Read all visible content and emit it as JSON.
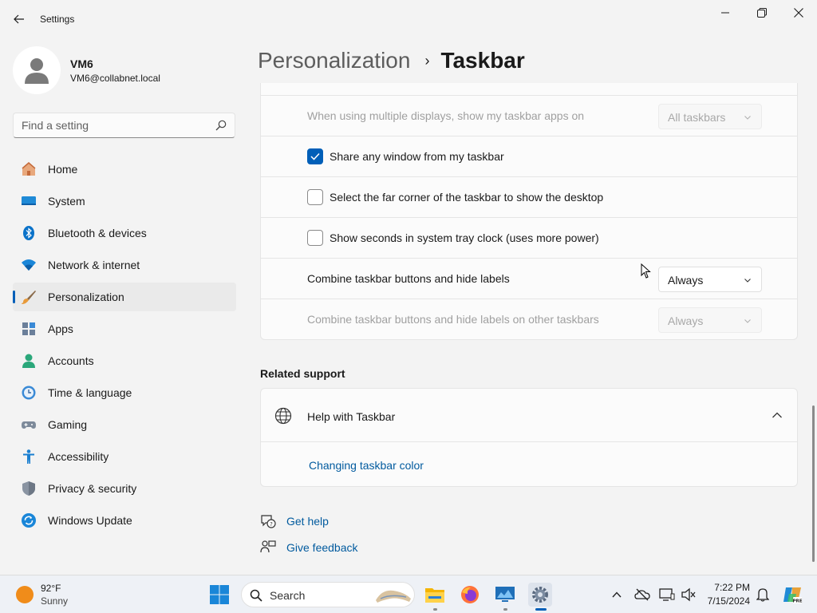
{
  "window": {
    "title": "Settings"
  },
  "user": {
    "name": "VM6",
    "email": "VM6@collabnet.local"
  },
  "search": {
    "placeholder": "Find a setting"
  },
  "sidebar": {
    "items": [
      {
        "label": "Home",
        "icon": "home-icon"
      },
      {
        "label": "System",
        "icon": "system-icon"
      },
      {
        "label": "Bluetooth & devices",
        "icon": "bluetooth-icon"
      },
      {
        "label": "Network & internet",
        "icon": "wifi-icon"
      },
      {
        "label": "Personalization",
        "icon": "brush-icon",
        "active": true
      },
      {
        "label": "Apps",
        "icon": "apps-icon"
      },
      {
        "label": "Accounts",
        "icon": "accounts-icon"
      },
      {
        "label": "Time & language",
        "icon": "clock-globe-icon"
      },
      {
        "label": "Gaming",
        "icon": "gamepad-icon"
      },
      {
        "label": "Accessibility",
        "icon": "accessibility-icon"
      },
      {
        "label": "Privacy & security",
        "icon": "shield-icon"
      },
      {
        "label": "Windows Update",
        "icon": "update-icon"
      }
    ]
  },
  "breadcrumb": {
    "parent": "Personalization",
    "separator": "›",
    "current": "Taskbar"
  },
  "settings": {
    "multi_display_label": "When using multiple displays, show my taskbar apps on",
    "multi_display_value": "All taskbars",
    "share_window_label": "Share any window from my taskbar",
    "share_window_checked": true,
    "far_corner_label": "Select the far corner of the taskbar to show the desktop",
    "far_corner_checked": false,
    "show_seconds_label": "Show seconds in system tray clock (uses more power)",
    "show_seconds_checked": false,
    "combine_label": "Combine taskbar buttons and hide labels",
    "combine_value": "Always",
    "combine_other_label": "Combine taskbar buttons and hide labels on other taskbars",
    "combine_other_value": "Always"
  },
  "related": {
    "title": "Related support",
    "help_title": "Help with Taskbar",
    "help_link": "Changing taskbar color"
  },
  "footer": {
    "get_help": "Get help",
    "give_feedback": "Give feedback"
  },
  "taskbar": {
    "weather_temp": "92°F",
    "weather_cond": "Sunny",
    "search_label": "Search",
    "time": "7:22 PM",
    "date": "7/15/2024",
    "apps": [
      "file-explorer-icon",
      "firefox-icon",
      "remote-desktop-icon",
      "settings-icon"
    ]
  },
  "colors": {
    "accent": "#005fb8",
    "link": "#005a9e",
    "background": "#f3f3f3",
    "card": "#fbfbfb"
  }
}
